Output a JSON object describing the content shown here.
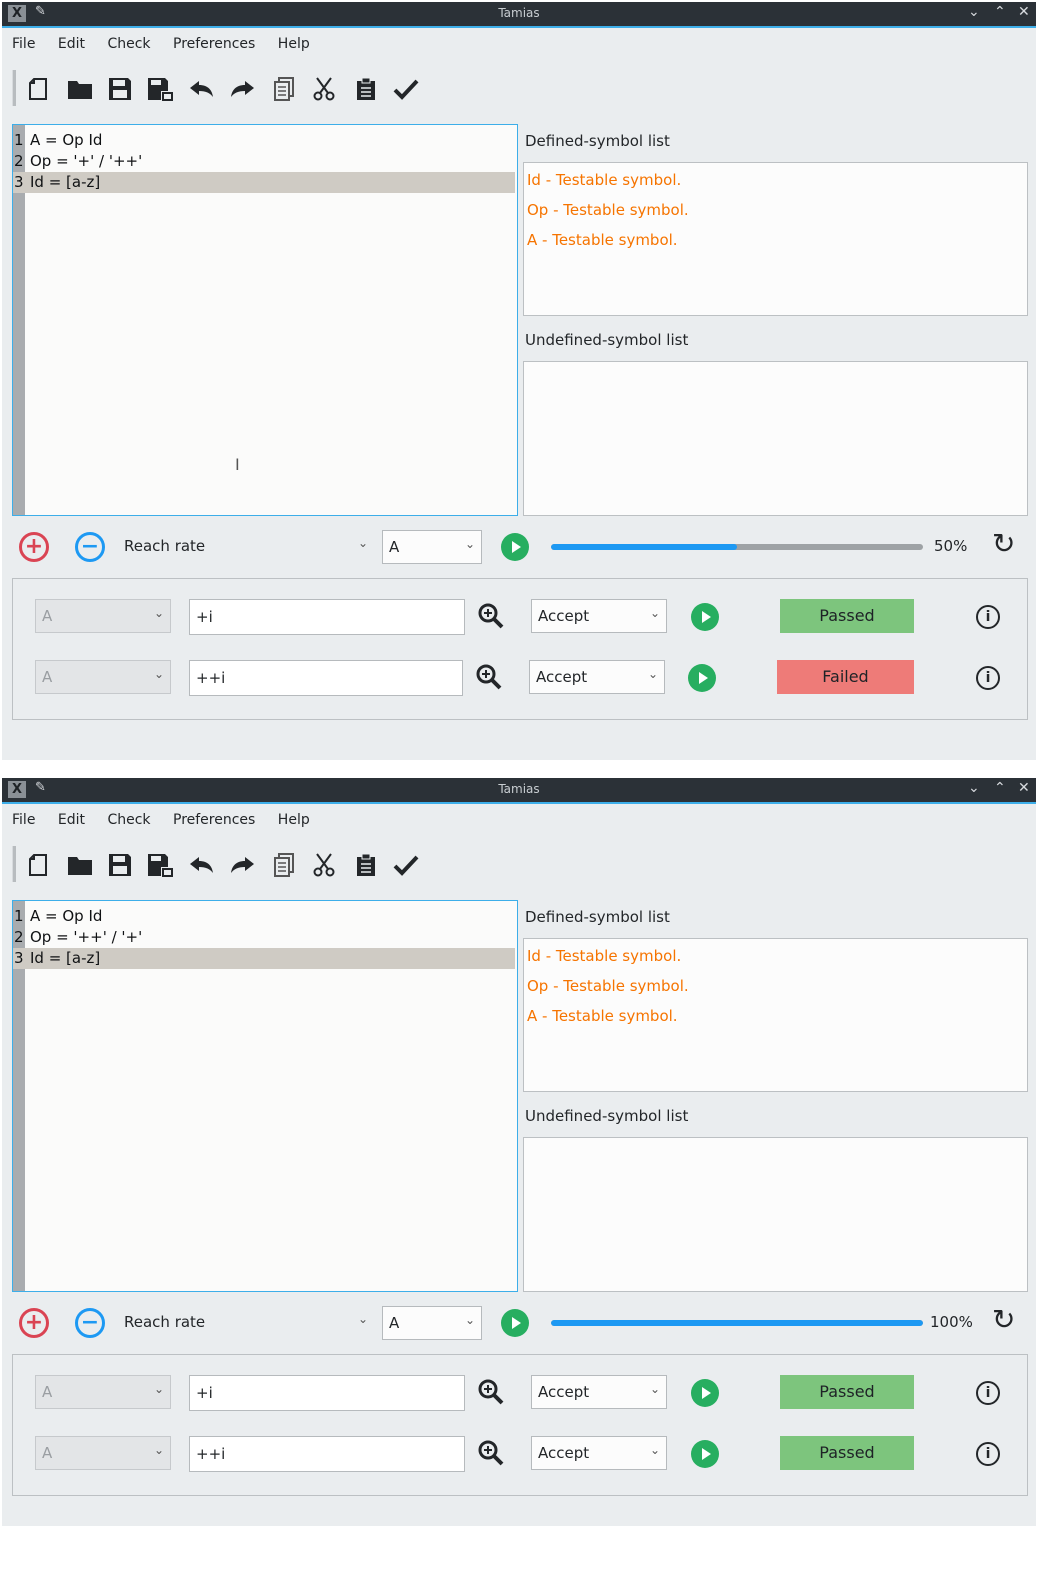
{
  "windows": [
    {
      "title": "Tamias",
      "menu": [
        "File",
        "Edit",
        "Check",
        "Preferences",
        "Help"
      ],
      "editor_lines": [
        {
          "num": "1",
          "text": "A = Op Id"
        },
        {
          "num": "2",
          "text": "Op = '+' / '++'"
        },
        {
          "num": "3",
          "text": "Id = [a-z]"
        }
      ],
      "defined_label": "Defined-symbol list",
      "defined_items": [
        "Id - Testable symbol.",
        "Op - Testable symbol.",
        "A - Testable symbol."
      ],
      "undefined_label": "Undefined-symbol list",
      "metric": "Reach rate",
      "start_symbol": "A",
      "progress_text": "50%",
      "progress_value": 50,
      "tests": [
        {
          "symbol": "A",
          "input": "+i",
          "expect": "Accept",
          "status": "Passed"
        },
        {
          "symbol": "A",
          "input": "++i",
          "expect": "Accept",
          "status": "Failed"
        }
      ]
    },
    {
      "title": "Tamias",
      "menu": [
        "File",
        "Edit",
        "Check",
        "Preferences",
        "Help"
      ],
      "editor_lines": [
        {
          "num": "1",
          "text": "A = Op Id"
        },
        {
          "num": "2",
          "text": "Op = '++' / '+'"
        },
        {
          "num": "3",
          "text": "Id = [a-z]"
        }
      ],
      "defined_label": "Defined-symbol list",
      "defined_items": [
        "Id - Testable symbol.",
        "Op - Testable symbol.",
        "A - Testable symbol."
      ],
      "undefined_label": "Undefined-symbol list",
      "metric": "Reach rate",
      "start_symbol": "A",
      "progress_text": "100%",
      "progress_value": 100,
      "tests": [
        {
          "symbol": "A",
          "input": "+i",
          "expect": "Accept",
          "status": "Passed"
        },
        {
          "symbol": "A",
          "input": "++i",
          "expect": "Accept",
          "status": "Passed"
        }
      ]
    }
  ],
  "colors": {
    "accent": "#3daee9",
    "defined_symbol": "#f67400",
    "passed": "#7dc57d",
    "failed": "#ee7b78",
    "play": "#27ae60"
  },
  "icons": [
    "new-file-icon",
    "open-folder-icon",
    "save-icon",
    "save-as-icon",
    "undo-icon",
    "redo-icon",
    "copy-icon",
    "cut-icon",
    "paste-icon",
    "check-icon"
  ]
}
